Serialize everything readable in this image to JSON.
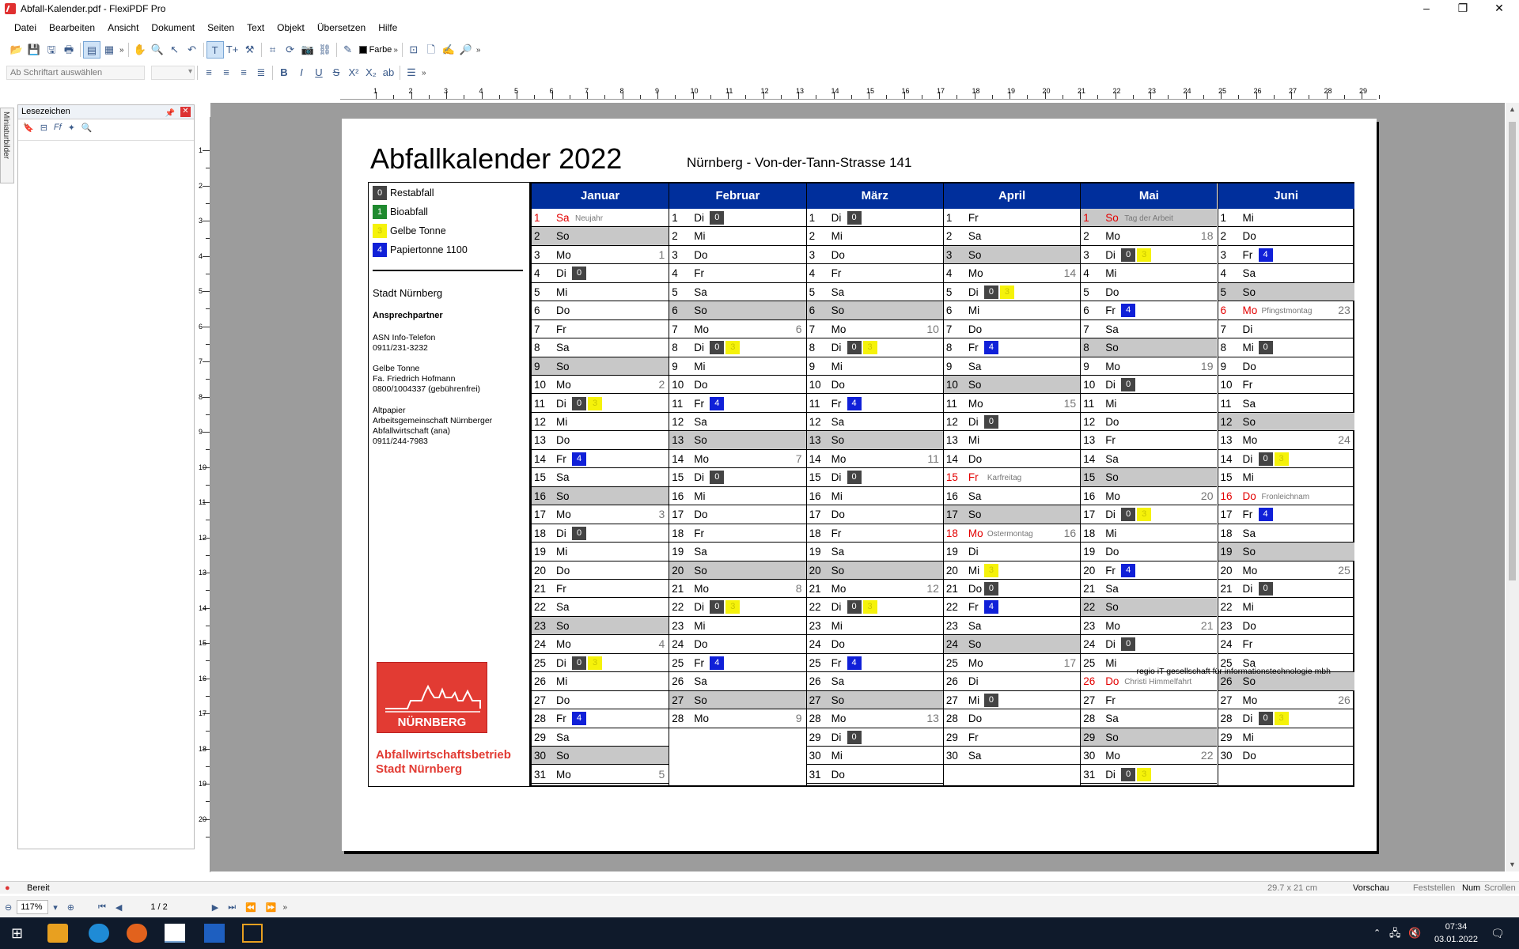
{
  "window": {
    "title": "Abfall-Kalender.pdf - FlexiPDF Pro"
  },
  "menu": [
    "Datei",
    "Bearbeiten",
    "Ansicht",
    "Dokument",
    "Seiten",
    "Text",
    "Objekt",
    "Übersetzen",
    "Hilfe"
  ],
  "toolbar": {
    "color_label": "Farbe",
    "font_placeholder": "Ab Schriftart auswählen"
  },
  "ruler": {
    "h": [
      "1",
      "2",
      "3",
      "4",
      "5",
      "6",
      "7",
      "8",
      "9",
      "10",
      "11",
      "12",
      "13",
      "14",
      "15",
      "16",
      "17",
      "18",
      "19",
      "20",
      "21",
      "22",
      "23",
      "24",
      "25",
      "26",
      "27",
      "28",
      "29"
    ],
    "v": [
      "1",
      "2",
      "3",
      "4",
      "5",
      "6",
      "7",
      "8",
      "9",
      "10",
      "11",
      "12",
      "13",
      "14",
      "15",
      "16",
      "17",
      "18",
      "19",
      "20"
    ]
  },
  "sidebar": {
    "tab_label": "Miniaturbilder",
    "panel_title": "Lesezeichen"
  },
  "document": {
    "title": "Abfallkalender 2022",
    "address": "Nürnberg - Von-der-Tann-Strasse 141",
    "footer": "regio iT gesellschaft für informationstechnologie mbh",
    "legend": [
      {
        "code": "0",
        "label": "Restabfall",
        "color": "#444444"
      },
      {
        "code": "1",
        "label": "Bioabfall",
        "color": "#1f8a2f"
      },
      {
        "code": "3",
        "label": "Gelbe Tonne",
        "color": "#f5f20a"
      },
      {
        "code": "4",
        "label": "Papiertonne 1100",
        "color": "#1020d8"
      }
    ],
    "city": "Stadt Nürnberg",
    "contact_head": "Ansprechpartner",
    "contacts": [
      [
        "ASN Info-Telefon",
        "0911/231-3232"
      ],
      [
        "Gelbe Tonne",
        "Fa. Friedrich Hofmann",
        "0800/1004337 (gebührenfrei)"
      ],
      [
        "Altpapier",
        "Arbeitsgemeinschaft Nürnberger",
        "Abfallwirtschaft (ana)",
        "0911/244-7983"
      ]
    ],
    "logo_word": "NÜRNBERG",
    "logo_text": [
      "Abfallwirtschaftsbetrieb",
      "Stadt Nürnberg"
    ]
  },
  "calendar": {
    "months": [
      {
        "name": "Januar",
        "days": [
          {
            "d": "1",
            "w": "Sa",
            "hol": "Neujahr",
            "we": false
          },
          {
            "d": "2",
            "w": "So",
            "we": true
          },
          {
            "d": "3",
            "w": "Mo",
            "kw": "1"
          },
          {
            "d": "4",
            "w": "Di",
            "m": [
              "0"
            ]
          },
          {
            "d": "5",
            "w": "Mi"
          },
          {
            "d": "6",
            "w": "Do"
          },
          {
            "d": "7",
            "w": "Fr"
          },
          {
            "d": "8",
            "w": "Sa"
          },
          {
            "d": "9",
            "w": "So",
            "we": true
          },
          {
            "d": "10",
            "w": "Mo",
            "kw": "2"
          },
          {
            "d": "11",
            "w": "Di",
            "m": [
              "0",
              "3"
            ]
          },
          {
            "d": "12",
            "w": "Mi"
          },
          {
            "d": "13",
            "w": "Do"
          },
          {
            "d": "14",
            "w": "Fr",
            "m": [
              "4"
            ]
          },
          {
            "d": "15",
            "w": "Sa"
          },
          {
            "d": "16",
            "w": "So",
            "we": true
          },
          {
            "d": "17",
            "w": "Mo",
            "kw": "3"
          },
          {
            "d": "18",
            "w": "Di",
            "m": [
              "0"
            ]
          },
          {
            "d": "19",
            "w": "Mi"
          },
          {
            "d": "20",
            "w": "Do"
          },
          {
            "d": "21",
            "w": "Fr"
          },
          {
            "d": "22",
            "w": "Sa"
          },
          {
            "d": "23",
            "w": "So",
            "we": true
          },
          {
            "d": "24",
            "w": "Mo",
            "kw": "4"
          },
          {
            "d": "25",
            "w": "Di",
            "m": [
              "0",
              "3"
            ]
          },
          {
            "d": "26",
            "w": "Mi"
          },
          {
            "d": "27",
            "w": "Do"
          },
          {
            "d": "28",
            "w": "Fr",
            "m": [
              "4"
            ]
          },
          {
            "d": "29",
            "w": "Sa"
          },
          {
            "d": "30",
            "w": "So",
            "we": true
          },
          {
            "d": "31",
            "w": "Mo",
            "kw": "5"
          }
        ]
      },
      {
        "name": "Februar",
        "days": [
          {
            "d": "1",
            "w": "Di",
            "m": [
              "0"
            ]
          },
          {
            "d": "2",
            "w": "Mi"
          },
          {
            "d": "3",
            "w": "Do"
          },
          {
            "d": "4",
            "w": "Fr"
          },
          {
            "d": "5",
            "w": "Sa"
          },
          {
            "d": "6",
            "w": "So",
            "we": true
          },
          {
            "d": "7",
            "w": "Mo",
            "kw": "6"
          },
          {
            "d": "8",
            "w": "Di",
            "m": [
              "0",
              "3"
            ]
          },
          {
            "d": "9",
            "w": "Mi"
          },
          {
            "d": "10",
            "w": "Do"
          },
          {
            "d": "11",
            "w": "Fr",
            "m": [
              "4"
            ]
          },
          {
            "d": "12",
            "w": "Sa"
          },
          {
            "d": "13",
            "w": "So",
            "we": true
          },
          {
            "d": "14",
            "w": "Mo",
            "kw": "7"
          },
          {
            "d": "15",
            "w": "Di",
            "m": [
              "0"
            ]
          },
          {
            "d": "16",
            "w": "Mi"
          },
          {
            "d": "17",
            "w": "Do"
          },
          {
            "d": "18",
            "w": "Fr"
          },
          {
            "d": "19",
            "w": "Sa"
          },
          {
            "d": "20",
            "w": "So",
            "we": true
          },
          {
            "d": "21",
            "w": "Mo",
            "kw": "8"
          },
          {
            "d": "22",
            "w": "Di",
            "m": [
              "0",
              "3"
            ]
          },
          {
            "d": "23",
            "w": "Mi"
          },
          {
            "d": "24",
            "w": "Do"
          },
          {
            "d": "25",
            "w": "Fr",
            "m": [
              "4"
            ]
          },
          {
            "d": "26",
            "w": "Sa"
          },
          {
            "d": "27",
            "w": "So",
            "we": true
          },
          {
            "d": "28",
            "w": "Mo",
            "kw": "9"
          }
        ]
      },
      {
        "name": "März",
        "days": [
          {
            "d": "1",
            "w": "Di",
            "m": [
              "0"
            ]
          },
          {
            "d": "2",
            "w": "Mi"
          },
          {
            "d": "3",
            "w": "Do"
          },
          {
            "d": "4",
            "w": "Fr"
          },
          {
            "d": "5",
            "w": "Sa"
          },
          {
            "d": "6",
            "w": "So",
            "we": true
          },
          {
            "d": "7",
            "w": "Mo",
            "kw": "10"
          },
          {
            "d": "8",
            "w": "Di",
            "m": [
              "0",
              "3"
            ]
          },
          {
            "d": "9",
            "w": "Mi"
          },
          {
            "d": "10",
            "w": "Do"
          },
          {
            "d": "11",
            "w": "Fr",
            "m": [
              "4"
            ]
          },
          {
            "d": "12",
            "w": "Sa"
          },
          {
            "d": "13",
            "w": "So",
            "we": true
          },
          {
            "d": "14",
            "w": "Mo",
            "kw": "11"
          },
          {
            "d": "15",
            "w": "Di",
            "m": [
              "0"
            ]
          },
          {
            "d": "16",
            "w": "Mi"
          },
          {
            "d": "17",
            "w": "Do"
          },
          {
            "d": "18",
            "w": "Fr"
          },
          {
            "d": "19",
            "w": "Sa"
          },
          {
            "d": "20",
            "w": "So",
            "we": true
          },
          {
            "d": "21",
            "w": "Mo",
            "kw": "12"
          },
          {
            "d": "22",
            "w": "Di",
            "m": [
              "0",
              "3"
            ]
          },
          {
            "d": "23",
            "w": "Mi"
          },
          {
            "d": "24",
            "w": "Do"
          },
          {
            "d": "25",
            "w": "Fr",
            "m": [
              "4"
            ]
          },
          {
            "d": "26",
            "w": "Sa"
          },
          {
            "d": "27",
            "w": "So",
            "we": true
          },
          {
            "d": "28",
            "w": "Mo",
            "kw": "13"
          },
          {
            "d": "29",
            "w": "Di",
            "m": [
              "0"
            ]
          },
          {
            "d": "30",
            "w": "Mi"
          },
          {
            "d": "31",
            "w": "Do"
          }
        ]
      },
      {
        "name": "April",
        "days": [
          {
            "d": "1",
            "w": "Fr"
          },
          {
            "d": "2",
            "w": "Sa"
          },
          {
            "d": "3",
            "w": "So",
            "we": true
          },
          {
            "d": "4",
            "w": "Mo",
            "kw": "14"
          },
          {
            "d": "5",
            "w": "Di",
            "m": [
              "0",
              "3"
            ]
          },
          {
            "d": "6",
            "w": "Mi"
          },
          {
            "d": "7",
            "w": "Do"
          },
          {
            "d": "8",
            "w": "Fr",
            "m": [
              "4"
            ]
          },
          {
            "d": "9",
            "w": "Sa"
          },
          {
            "d": "10",
            "w": "So",
            "we": true
          },
          {
            "d": "11",
            "w": "Mo",
            "kw": "15"
          },
          {
            "d": "12",
            "w": "Di",
            "m": [
              "0"
            ]
          },
          {
            "d": "13",
            "w": "Mi"
          },
          {
            "d": "14",
            "w": "Do"
          },
          {
            "d": "15",
            "w": "Fr",
            "hol": "Karfreitag"
          },
          {
            "d": "16",
            "w": "Sa"
          },
          {
            "d": "17",
            "w": "So",
            "we": true
          },
          {
            "d": "18",
            "w": "Mo",
            "hol": "Ostermontag",
            "kw": "16"
          },
          {
            "d": "19",
            "w": "Di"
          },
          {
            "d": "20",
            "w": "Mi",
            "m": [
              "3"
            ]
          },
          {
            "d": "21",
            "w": "Do",
            "m": [
              "0"
            ]
          },
          {
            "d": "22",
            "w": "Fr",
            "m": [
              "4"
            ]
          },
          {
            "d": "23",
            "w": "Sa"
          },
          {
            "d": "24",
            "w": "So",
            "we": true
          },
          {
            "d": "25",
            "w": "Mo",
            "kw": "17"
          },
          {
            "d": "26",
            "w": "Di"
          },
          {
            "d": "27",
            "w": "Mi",
            "m": [
              "0"
            ]
          },
          {
            "d": "28",
            "w": "Do"
          },
          {
            "d": "29",
            "w": "Fr"
          },
          {
            "d": "30",
            "w": "Sa"
          }
        ]
      },
      {
        "name": "Mai",
        "days": [
          {
            "d": "1",
            "w": "So",
            "hol": "Tag der Arbeit",
            "we": true
          },
          {
            "d": "2",
            "w": "Mo",
            "kw": "18"
          },
          {
            "d": "3",
            "w": "Di",
            "m": [
              "0",
              "3"
            ]
          },
          {
            "d": "4",
            "w": "Mi"
          },
          {
            "d": "5",
            "w": "Do"
          },
          {
            "d": "6",
            "w": "Fr",
            "m": [
              "4"
            ]
          },
          {
            "d": "7",
            "w": "Sa"
          },
          {
            "d": "8",
            "w": "So",
            "we": true
          },
          {
            "d": "9",
            "w": "Mo",
            "kw": "19"
          },
          {
            "d": "10",
            "w": "Di",
            "m": [
              "0"
            ]
          },
          {
            "d": "11",
            "w": "Mi"
          },
          {
            "d": "12",
            "w": "Do"
          },
          {
            "d": "13",
            "w": "Fr"
          },
          {
            "d": "14",
            "w": "Sa"
          },
          {
            "d": "15",
            "w": "So",
            "we": true
          },
          {
            "d": "16",
            "w": "Mo",
            "kw": "20"
          },
          {
            "d": "17",
            "w": "Di",
            "m": [
              "0",
              "3"
            ]
          },
          {
            "d": "18",
            "w": "Mi"
          },
          {
            "d": "19",
            "w": "Do"
          },
          {
            "d": "20",
            "w": "Fr",
            "m": [
              "4"
            ]
          },
          {
            "d": "21",
            "w": "Sa"
          },
          {
            "d": "22",
            "w": "So",
            "we": true
          },
          {
            "d": "23",
            "w": "Mo",
            "kw": "21"
          },
          {
            "d": "24",
            "w": "Di",
            "m": [
              "0"
            ]
          },
          {
            "d": "25",
            "w": "Mi"
          },
          {
            "d": "26",
            "w": "Do",
            "hol": "Christi Himmelfahrt"
          },
          {
            "d": "27",
            "w": "Fr"
          },
          {
            "d": "28",
            "w": "Sa"
          },
          {
            "d": "29",
            "w": "So",
            "we": true
          },
          {
            "d": "30",
            "w": "Mo",
            "kw": "22"
          },
          {
            "d": "31",
            "w": "Di",
            "m": [
              "0",
              "3"
            ]
          }
        ]
      },
      {
        "name": "Juni",
        "days": [
          {
            "d": "1",
            "w": "Mi"
          },
          {
            "d": "2",
            "w": "Do"
          },
          {
            "d": "3",
            "w": "Fr",
            "m": [
              "4"
            ]
          },
          {
            "d": "4",
            "w": "Sa"
          },
          {
            "d": "5",
            "w": "So",
            "we": true
          },
          {
            "d": "6",
            "w": "Mo",
            "hol": "Pfingstmontag",
            "kw": "23"
          },
          {
            "d": "7",
            "w": "Di"
          },
          {
            "d": "8",
            "w": "Mi",
            "m": [
              "0"
            ]
          },
          {
            "d": "9",
            "w": "Do"
          },
          {
            "d": "10",
            "w": "Fr"
          },
          {
            "d": "11",
            "w": "Sa"
          },
          {
            "d": "12",
            "w": "So",
            "we": true
          },
          {
            "d": "13",
            "w": "Mo",
            "kw": "24"
          },
          {
            "d": "14",
            "w": "Di",
            "m": [
              "0",
              "3"
            ]
          },
          {
            "d": "15",
            "w": "Mi"
          },
          {
            "d": "16",
            "w": "Do",
            "hol": "Fronleichnam"
          },
          {
            "d": "17",
            "w": "Fr",
            "m": [
              "4"
            ]
          },
          {
            "d": "18",
            "w": "Sa"
          },
          {
            "d": "19",
            "w": "So",
            "we": true
          },
          {
            "d": "20",
            "w": "Mo",
            "kw": "25"
          },
          {
            "d": "21",
            "w": "Di",
            "m": [
              "0"
            ]
          },
          {
            "d": "22",
            "w": "Mi"
          },
          {
            "d": "23",
            "w": "Do"
          },
          {
            "d": "24",
            "w": "Fr"
          },
          {
            "d": "25",
            "w": "Sa"
          },
          {
            "d": "26",
            "w": "So",
            "we": true
          },
          {
            "d": "27",
            "w": "Mo",
            "kw": "26"
          },
          {
            "d": "28",
            "w": "Di",
            "m": [
              "0",
              "3"
            ]
          },
          {
            "d": "29",
            "w": "Mi"
          },
          {
            "d": "30",
            "w": "Do"
          }
        ]
      }
    ]
  },
  "status": {
    "text": "Bereit",
    "page_size": "29.7 x 21 cm",
    "mode": "Vorschau",
    "flags": [
      "Feststellen",
      "Num",
      "Scrollen"
    ]
  },
  "nav": {
    "zoom": "117%",
    "page": "1 / 2"
  },
  "clock": {
    "time": "07:34",
    "date": "03.01.2022"
  },
  "colors": {
    "month_header": "#002f9c",
    "weekend": "#c8c8c8",
    "holiday": "#e30000",
    "logo_red": "#e23b33"
  },
  "icons": [
    "open-icon",
    "save-icon",
    "print-icon",
    "hand-icon",
    "zoom-icon",
    "text-tool-icon",
    "crop-icon",
    "camera-icon",
    "link-icon",
    "pipette-icon",
    "bold-icon",
    "italic-icon",
    "underline-icon"
  ]
}
